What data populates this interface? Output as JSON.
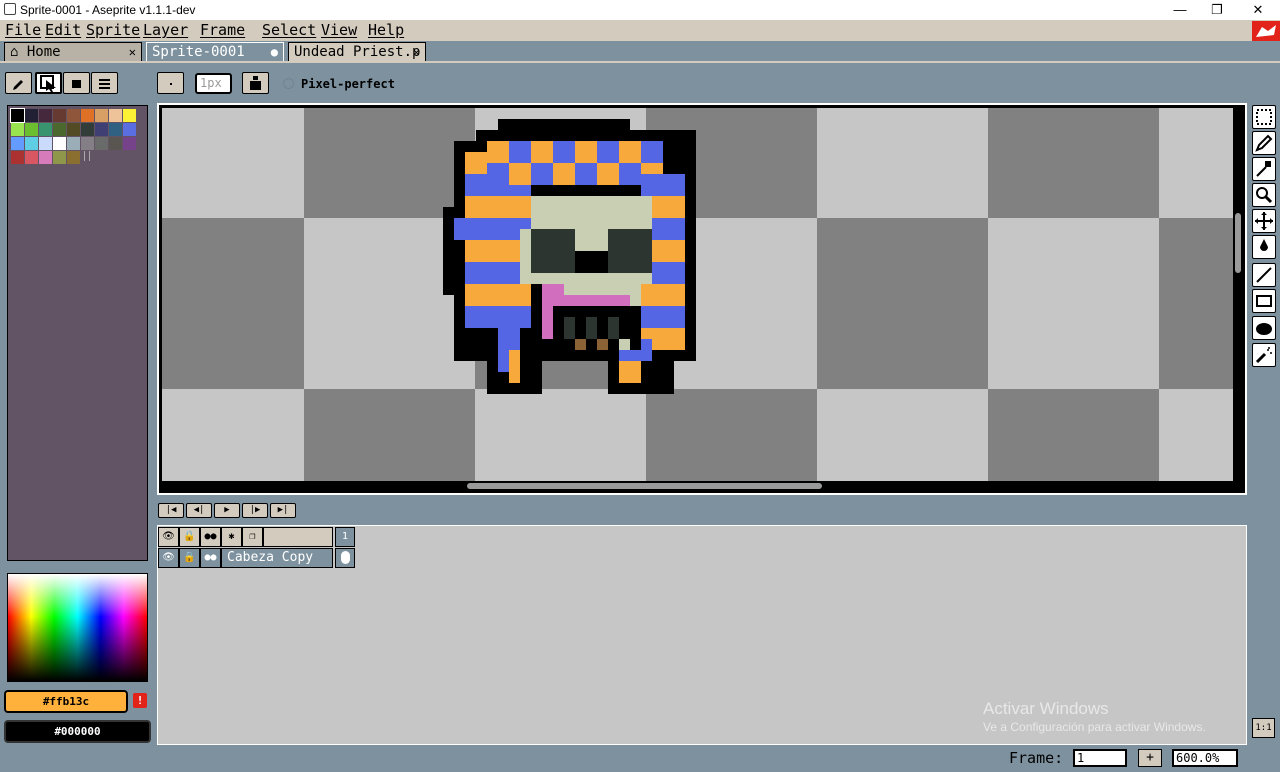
{
  "window": {
    "title": "Sprite-0001 - Aseprite v1.1.1-dev",
    "minimize_glyph": "—",
    "maximize_glyph": "❐",
    "close_glyph": "✕"
  },
  "menu": [
    "File",
    "Edit",
    "Sprite",
    "Layer",
    "Frame",
    "Select",
    "View",
    "Help"
  ],
  "tabs": [
    {
      "label": "Home",
      "close": "✕"
    },
    {
      "label": "Sprite-0001",
      "close": "●"
    },
    {
      "label": "Undead Priest.p",
      "close": "✕"
    }
  ],
  "context_bar": {
    "brush_size_value": "1px",
    "pixel_perfect_label": "Pixel-perfect"
  },
  "palette": {
    "colors": [
      "#000000",
      "#222034",
      "#45283c",
      "#663931",
      "#8f563b",
      "#df7126",
      "#d9a066",
      "#eec39a",
      "#fbf236",
      "#99e550",
      "#6abe30",
      "#37946e",
      "#4b692f",
      "#524b24",
      "#323c39",
      "#3f3f74",
      "#306082",
      "#5b6ee1",
      "#639bff",
      "#5fcde4",
      "#cbdbfc",
      "#ffffff",
      "#9badb7",
      "#847e87",
      "#696a6a",
      "#595652",
      "#76428a",
      "#ac3232",
      "#d95763",
      "#d77bba",
      "#8f974a",
      "#8a6f30"
    ]
  },
  "timeline": {
    "frame_column_label": "1",
    "layer": {
      "name": "Cabeza Copy"
    }
  },
  "colors": {
    "foreground_hex": "#ffb13c",
    "background_hex": "#000000",
    "foreground": "#ffb13c",
    "background": "#000000",
    "warning_glyph": "!"
  },
  "status": {
    "frame_label": "Frame:",
    "frame_value": "1",
    "add_frame_glyph": "+",
    "zoom_value": "600.0%",
    "zoom_reset_label": "1:1"
  },
  "watermark": {
    "title": "Activar Windows",
    "subtitle": "Ve a Configuración para activar Windows."
  },
  "sprite_colors": {
    "orange": "#f7a93b",
    "blue": "#5566e5",
    "face": "#c8cfb2",
    "dark": "#2c3530",
    "pink": "#d16fbe",
    "brown": "#8a6236",
    "outline": "#000000"
  }
}
